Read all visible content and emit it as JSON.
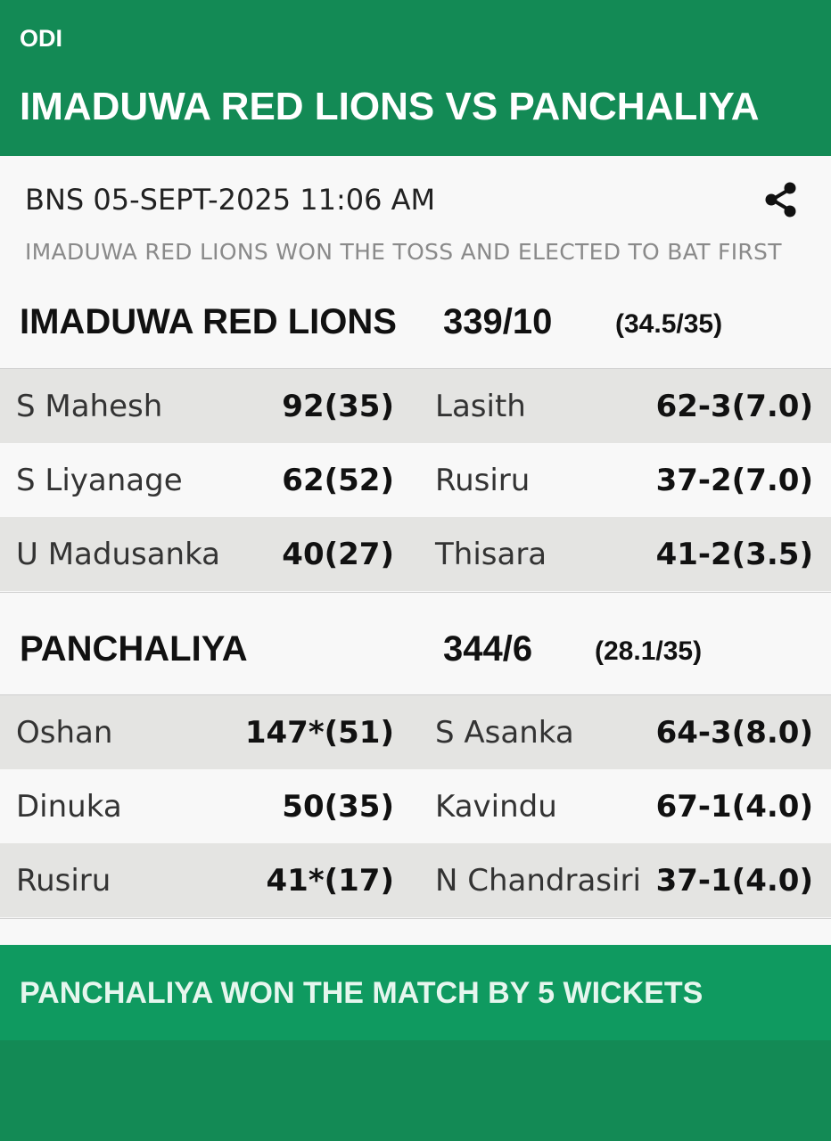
{
  "header": {
    "format": "ODI",
    "title": "IMADUWA RED LIONS VS PANCHALIYA"
  },
  "match": {
    "datetime": "BNS 05-SEPT-2025 11:06 AM",
    "toss": "IMADUWA RED LIONS WON THE TOSS AND ELECTED TO BAT FIRST",
    "share_icon": "share-icon"
  },
  "innings": [
    {
      "team": "IMADUWA RED LIONS",
      "score": "339/10",
      "overs": "(34.5/35)",
      "rows": [
        {
          "batter": "S Mahesh",
          "bat_fig": "92(35)",
          "bowler": "Lasith",
          "bowl_fig": "62-3(7.0)"
        },
        {
          "batter": "S Liyanage",
          "bat_fig": "62(52)",
          "bowler": "Rusiru",
          "bowl_fig": "37-2(7.0)"
        },
        {
          "batter": "U Madusanka",
          "bat_fig": "40(27)",
          "bowler": "Thisara",
          "bowl_fig": "41-2(3.5)"
        }
      ]
    },
    {
      "team": "PANCHALIYA",
      "score": "344/6",
      "overs": "(28.1/35)",
      "rows": [
        {
          "batter": "Oshan",
          "bat_fig": "147*(51)",
          "bowler": "S Asanka",
          "bowl_fig": "64-3(8.0)"
        },
        {
          "batter": "Dinuka",
          "bat_fig": "50(35)",
          "bowler": "Kavindu",
          "bowl_fig": "67-1(4.0)"
        },
        {
          "batter": "Rusiru",
          "bat_fig": "41*(17)",
          "bowler": "N Chandrasiri",
          "bowl_fig": "37-1(4.0)"
        }
      ]
    }
  ],
  "result": "PANCHALIYA WON THE MATCH BY 5 WICKETS",
  "colors": {
    "brand_green": "#138a55",
    "result_green": "#0f9a60",
    "row_shade": "#e4e4e2",
    "card_bg": "#f8f8f8"
  }
}
